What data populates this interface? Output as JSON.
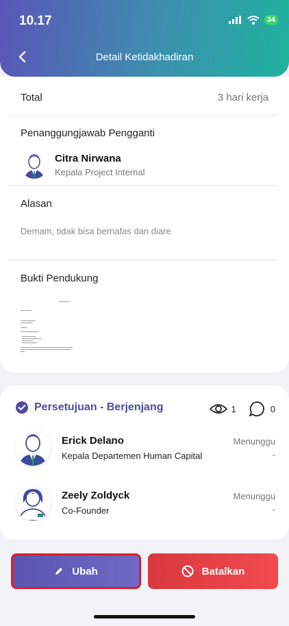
{
  "status_bar": {
    "time": "10.17",
    "battery": "34"
  },
  "header": {
    "title": "Detail Ketidakhadiran"
  },
  "summary": {
    "total_label": "Total",
    "total_value": "3 hari kerja"
  },
  "substitute": {
    "label": "Penanggungjawab Pengganti",
    "name": "Citra Nirwana",
    "role": "Kepala Project Internal"
  },
  "reason": {
    "label": "Alasan",
    "text": "Demam, tidak bisa bernafas dan diare"
  },
  "evidence": {
    "label": "Bukti Pendukung"
  },
  "approval": {
    "title": "Persetujuan - Berjenjang",
    "views": "1",
    "comments": "0",
    "approvers": [
      {
        "name": "Erick Delano",
        "role": "Kepala Departemen Human Capital",
        "status": "Menunggu",
        "date": "-"
      },
      {
        "name": "Zeely Zoldyck",
        "role": "Co-Founder",
        "status": "Menunggu",
        "date": "-"
      }
    ]
  },
  "actions": {
    "edit_label": "Ubah",
    "cancel_label": "Batalkan"
  },
  "colors": {
    "accent": "#4e4aa0",
    "danger": "#e8403f",
    "header_start": "#5a55b8",
    "header_end": "#1fb39e"
  }
}
